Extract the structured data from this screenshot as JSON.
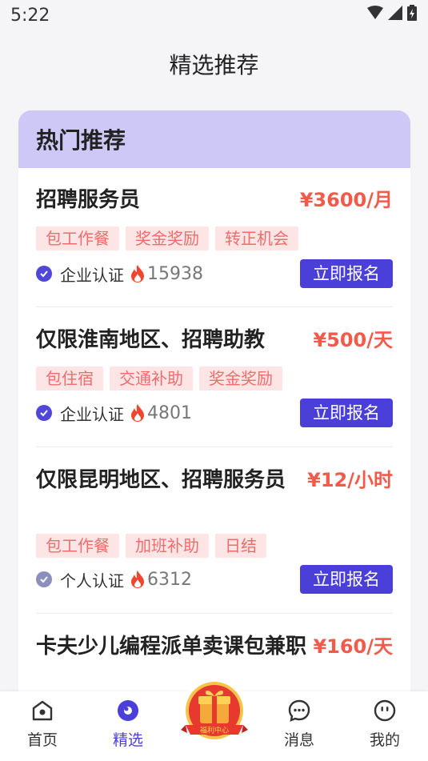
{
  "status_bar": {
    "time": "5:22"
  },
  "page_title": "精选推荐",
  "section": {
    "title": "热门推荐"
  },
  "jobs": [
    {
      "title": "招聘服务员",
      "salary": "¥3600/月",
      "tags": [
        "包工作餐",
        "奖金奖励",
        "转正机会"
      ],
      "cert": "企业认证",
      "views": "15938",
      "apply": "立即报名"
    },
    {
      "title": "仅限淮南地区、招聘助教",
      "salary": "¥500/天",
      "tags": [
        "包住宿",
        "交通补助",
        "奖金奖励"
      ],
      "cert": "企业认证",
      "views": "4801",
      "apply": "立即报名"
    },
    {
      "title": "仅限昆明地区、招聘服务员",
      "salary": "¥12/小时",
      "tags": [
        "包工作餐",
        "加班补助",
        "日结"
      ],
      "cert": "个人认证",
      "views": "6312",
      "apply": "立即报名"
    },
    {
      "title": "卡夫少儿编程派单卖课包兼职",
      "salary": "¥160/天"
    }
  ],
  "tabbar": {
    "items": [
      {
        "label": "首页",
        "icon": "home-icon"
      },
      {
        "label": "精选",
        "icon": "featured-icon",
        "active": true
      },
      {
        "label": "消息",
        "icon": "message-icon"
      },
      {
        "label": "我的",
        "icon": "profile-icon"
      }
    ],
    "welfare_label": "福利中心"
  },
  "colors": {
    "accent": "#4a3fd9",
    "salary": "#f25a4a",
    "tag_bg": "#fde5e5",
    "tag_text": "#f06c6c",
    "header_bg": "#cdc8f6"
  }
}
